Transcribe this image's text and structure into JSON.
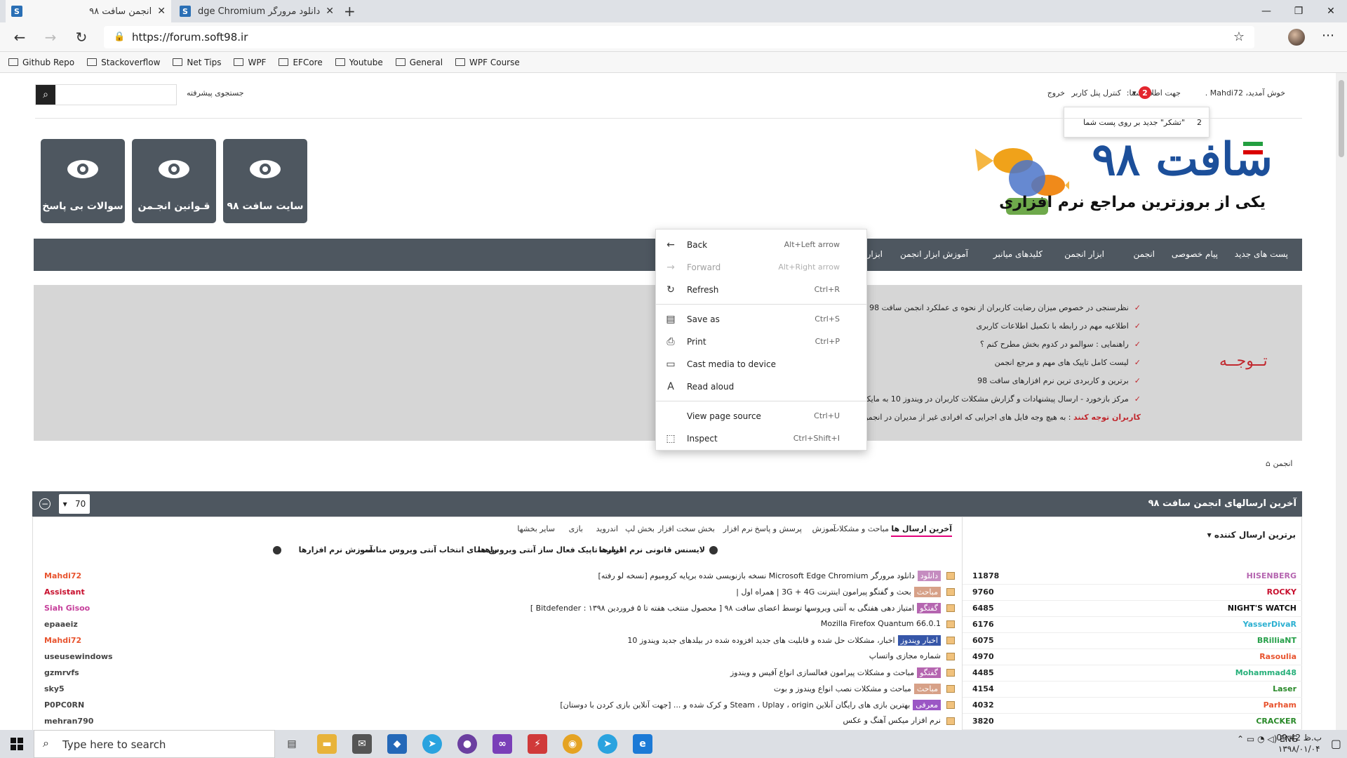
{
  "browser": {
    "tabs": [
      {
        "title": "انجمن سافت ۹۸",
        "active": true,
        "favicon": "S"
      },
      {
        "title": "دانلود مرورگر Microsoft Edge Chromium",
        "active": false,
        "favicon": "S"
      }
    ],
    "url": "https://forum.soft98.ir",
    "bookmarks": [
      "Github Repo",
      "Stackoverflow",
      "Net Tips",
      "WPF",
      "EFCore",
      "Youtube",
      "General",
      "WPF Course"
    ]
  },
  "topbar": {
    "search_label": "جستجوی پیشرفته",
    "welcome": "خوش آمدید، Mahdi72 .",
    "notif_label": "جهت اطلاع شما:",
    "notif_count": "2",
    "control_panel": "کنترل پنل کاربر",
    "logout": "خروج",
    "notif_popup_count": "2",
    "notif_popup_text": "\"تشکر\" جدید بر روی پست شما"
  },
  "quick_buttons": [
    "سایت سافت ۹۸",
    "قـوانین انجـمن",
    "سوالات بی پاسخ"
  ],
  "logo": {
    "title": "سافت ۹۸",
    "subtitle": "یکی از بروزترین مراجع نرم افزاری"
  },
  "menu": [
    "پست های جدید",
    "پیام خصوصی",
    "انجمن",
    "ابزار انجمن",
    "کلیدهای میانبر",
    "آموزش ابزار انجمن",
    "ابزار ار"
  ],
  "notice": {
    "heading": "تــوجــه",
    "items": [
      "نظرسنجی در خصوص میزان رضایت کاربران از نحوه ی عملکرد انجمن سافت 98 در سال 97",
      "اطلاعیه مهم در رابطه با تکمیل اطلاعات کاربری",
      "راهنمایی : سوالمو در کدوم بخش مطرح کنم ؟",
      "لیست کامل تاپیک های مهم و مرجع انجمن",
      "برترین و کاربردی ترین نرم افزارهای سافت 98",
      "مرکز بازخورد - ارسال پیشنهادات و گزارش مشکلات کاربران در ویندوز 10 به مایکروسافت"
    ],
    "warning_bold": "کاربران توجه کنند",
    "warning_rest": ": به هیچ وجه فایل های اجرایی که افرادی غیر از مدیران در انجمن قرار میدهند را دانلود و اجرا نکنید"
  },
  "breadcrumb": "انجمن",
  "forum": {
    "title": "آخرین ارسالهای انجمن سافت ۹۸",
    "count": "70",
    "tabs": [
      "آخرین ارسال ها",
      "مباحث و مشکلات",
      "آموزش",
      "پرسش و پاسخ",
      "نرم افزار",
      "بخش سخت افزار",
      "بخش لپ",
      "اندروید",
      "بازی",
      "سایر بخشها"
    ],
    "sublinks": [
      "لایسنس قانونی نرم افزارها",
      "لیست تاپیک فعال ساز آنتی ویروس ها",
      "راهنمای انتخاب آنتی ویروس مناسب",
      "آموزش نرم افزارها"
    ],
    "threads": [
      {
        "tag": "دانلود",
        "tag_color": "#c58cc0",
        "title": "دانلود مرورگر Microsoft Edge Chromium نسخه بازنویسی شده برپایه کرومیوم [نسخه لو رفته]",
        "user": "Mahdi72",
        "user_color": "#e8542f"
      },
      {
        "tag": "مباحث",
        "tag_color": "#d7a188",
        "title": "بحث و گفتگو پیرامون اینترنت 3G + 4G | همراه اول |",
        "user": "Assistant",
        "user_color": "#c8102e"
      },
      {
        "tag": "گفتگو",
        "tag_color": "#b565b0",
        "title": "امتیاز دهی هفتگی به آنتی ویروسها توسط اعضای سافت ۹۸ [ محصول منتخب هفته تا ۵ فروردین ۱۳۹۸ : Bitdefender ]",
        "user": "Siah Gisoo",
        "user_color": "#c63f9b"
      },
      {
        "tag": "",
        "tag_color": "",
        "title": "Mozilla Firefox Quantum 66.0.1",
        "user": "epaaeiz",
        "user_color": "#444"
      },
      {
        "tag": "اخبار ویندوز",
        "tag_color": "#3656a8",
        "title": "اخبار، مشکلات حل شده و قابلیت های جدید افزوده شده در بیلدهای جدید ویندوز 10",
        "user": "Mahdi72",
        "user_color": "#e8542f"
      },
      {
        "tag": "",
        "tag_color": "",
        "title": "شماره مجازی واتساپ",
        "user": "useusewindows",
        "user_color": "#444"
      },
      {
        "tag": "گفتگو",
        "tag_color": "#b565b0",
        "title": "مباحث و مشکلات پیرامون فعالسازی انواع آفیس و ویندوز",
        "user": "gzmrvfs",
        "user_color": "#444"
      },
      {
        "tag": "مباحث",
        "tag_color": "#d7a188",
        "title": "مباحث و مشکلات نصب انواع ویندوز و بوت",
        "user": "sky5",
        "user_color": "#444"
      },
      {
        "tag": "معرفی",
        "tag_color": "#9b57c5",
        "title": "بهترین بازی های رایگان آنلاین Steam ، Uplay ، origin و کرک شده و ... [جهت آنلاین بازی کردن با دوستان]",
        "user": "P0PC0RN",
        "user_color": "#444"
      },
      {
        "tag": "",
        "tag_color": "",
        "title": "نرم افزار میکس آهنگ و عکس",
        "user": "mehran790",
        "user_color": "#444"
      }
    ],
    "top_posters_label": "برترین ارسال کننده",
    "top_posters": [
      {
        "name": "HISENBERG",
        "count": "11878",
        "color": "#b565b0"
      },
      {
        "name": "ROCKY",
        "count": "9760",
        "color": "#c8102e"
      },
      {
        "name": "NIGHT'S WATCH",
        "count": "6485",
        "color": "#111"
      },
      {
        "name": "YasserDivaR",
        "count": "6176",
        "color": "#2bb0d1"
      },
      {
        "name": "BRilliaNT",
        "count": "6075",
        "color": "#27a04a"
      },
      {
        "name": "Rasoulia",
        "count": "4970",
        "color": "#e8542f"
      },
      {
        "name": "Mohammad48",
        "count": "4485",
        "color": "#27b07a"
      },
      {
        "name": "Laser",
        "count": "4154",
        "color": "#2a8a2a"
      },
      {
        "name": "Parham",
        "count": "4032",
        "color": "#e8542f"
      },
      {
        "name": "CRACKER",
        "count": "3820",
        "color": "#2a8a2a"
      }
    ]
  },
  "context_menu": [
    {
      "label": "Back",
      "shortcut": "Alt+Left arrow",
      "icon": "back-arrow-icon",
      "disabled": false
    },
    {
      "label": "Forward",
      "shortcut": "Alt+Right arrow",
      "icon": "forward-arrow-icon",
      "disabled": true
    },
    {
      "label": "Refresh",
      "shortcut": "Ctrl+R",
      "icon": "refresh-icon",
      "disabled": false
    },
    {
      "label": "Save as",
      "shortcut": "Ctrl+S",
      "icon": "save-icon",
      "disabled": false
    },
    {
      "label": "Print",
      "shortcut": "Ctrl+P",
      "icon": "print-icon",
      "disabled": false
    },
    {
      "label": "Cast media to device",
      "shortcut": "",
      "icon": "cast-icon",
      "disabled": false
    },
    {
      "label": "Read aloud",
      "shortcut": "",
      "icon": "read-aloud-icon",
      "disabled": false
    },
    {
      "label": "View page source",
      "shortcut": "Ctrl+U",
      "icon": "",
      "disabled": false
    },
    {
      "label": "Inspect",
      "shortcut": "Ctrl+Shift+I",
      "icon": "inspect-icon",
      "disabled": false
    }
  ],
  "taskbar": {
    "search_placeholder": "Type here to search",
    "lang": "ENG",
    "time": "ب.ظ 09:42",
    "date": "۱۳۹۸/۰۱/۰۴"
  }
}
